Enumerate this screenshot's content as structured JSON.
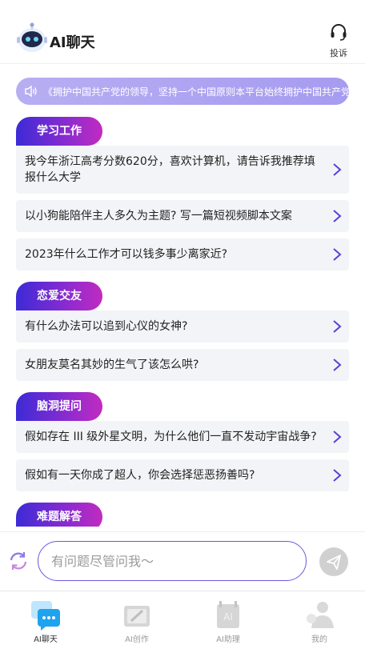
{
  "header": {
    "app_title": "AI聊天",
    "complain_label": "投诉"
  },
  "notice": {
    "text": "《拥护中国共产党的领导，坚持一个中国原则本平台始终拥护中国共产党"
  },
  "sections": [
    {
      "title": "学习工作",
      "questions": [
        "我今年浙江高考分数620分，喜欢计算机，请告诉我推荐填报什么大学",
        "以小狗能陪伴主人多久为主题? 写一篇短视频脚本文案",
        "2023年什么工作才可以钱多事少离家近?"
      ]
    },
    {
      "title": "恋爱交友",
      "questions": [
        "有什么办法可以追到心仪的女神?",
        "女朋友莫名其妙的生气了该怎么哄?"
      ]
    },
    {
      "title": "脑洞提问",
      "questions": [
        "假如存在 III 级外星文明，为什么他们一直不发动宇宙战争?",
        "假如有一天你成了超人，你会选择惩恶扬善吗?"
      ]
    },
    {
      "title": "难题解答",
      "questions": []
    }
  ],
  "input": {
    "placeholder": "有问题尽管问我～"
  },
  "tabs": [
    {
      "label": "AI聊天",
      "icon": "chat-icon",
      "active": true
    },
    {
      "label": "AI创作",
      "icon": "create-icon",
      "active": false
    },
    {
      "label": "AI助理",
      "icon": "assistant-icon",
      "active": false
    },
    {
      "label": "我的",
      "icon": "profile-icon",
      "active": false
    }
  ],
  "colors": {
    "accent": "#6c58e0",
    "tag_gradient_start": "#3c2bd6",
    "tag_gradient_end": "#c12bbf",
    "notice_bg": "#b0a6f1"
  }
}
